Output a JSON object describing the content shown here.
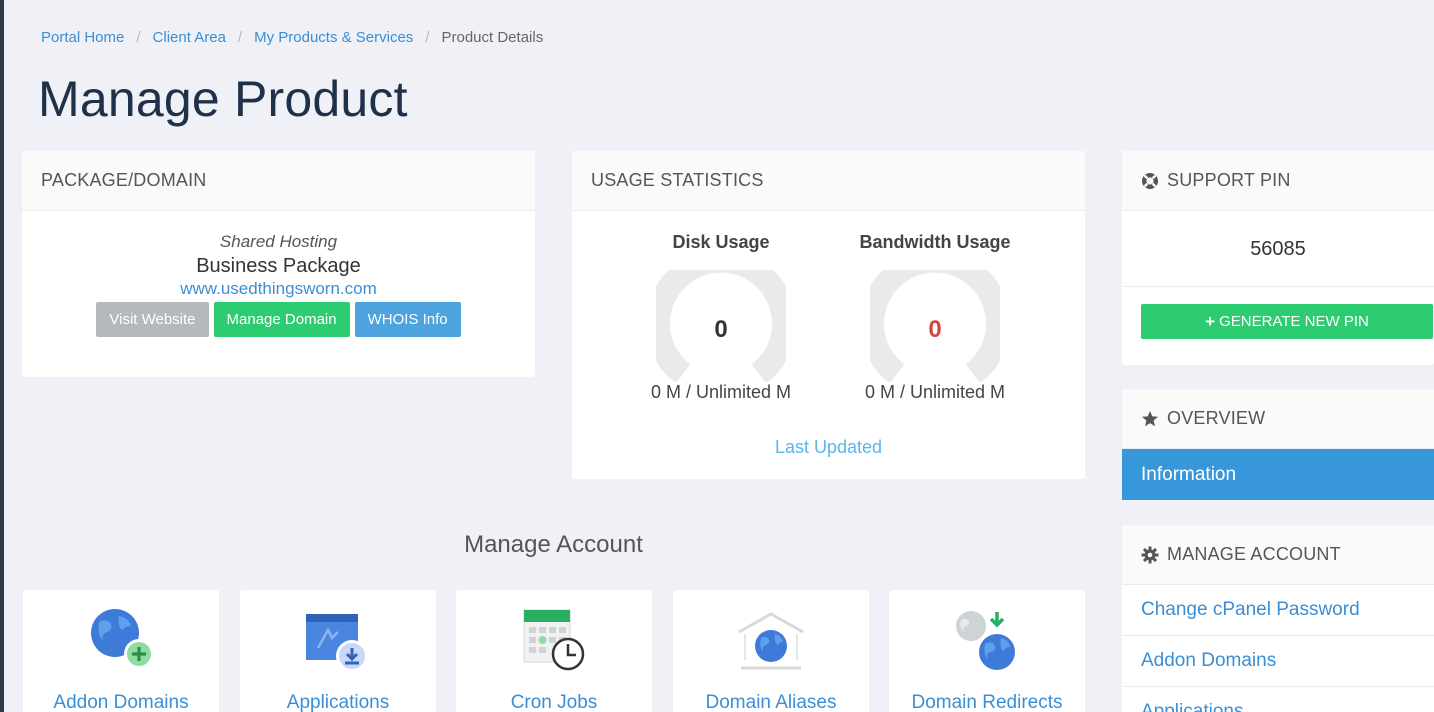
{
  "breadcrumb": {
    "items": [
      "Portal Home",
      "Client Area",
      "My Products & Services"
    ],
    "current": "Product Details"
  },
  "page_title": "Manage Product",
  "package_panel": {
    "heading": "PACKAGE/DOMAIN",
    "type": "Shared Hosting",
    "name": "Business Package",
    "domain": "www.usedthingsworn.com",
    "buttons": {
      "visit": "Visit Website",
      "manage_domain": "Manage Domain",
      "whois": "WHOIS Info"
    }
  },
  "usage_panel": {
    "heading": "USAGE STATISTICS",
    "disk": {
      "label": "Disk Usage",
      "value": "0",
      "amount": "0 M / Unlimited M"
    },
    "bandwidth": {
      "label": "Bandwidth Usage",
      "value": "0",
      "amount": "0 M / Unlimited M"
    },
    "last_updated": "Last Updated"
  },
  "support_pin": {
    "heading": "SUPPORT PIN",
    "icon": "life-ring-icon",
    "value": "56085",
    "button": "GENERATE NEW PIN"
  },
  "overview": {
    "heading": "OVERVIEW",
    "icon": "star-icon",
    "active_item": "Information"
  },
  "manage_sidebar": {
    "heading": "MANAGE ACCOUNT",
    "icon": "gear-icon",
    "links": [
      "Change cPanel Password",
      "Addon Domains",
      "Applications"
    ]
  },
  "manage_account": {
    "heading": "Manage Account",
    "tiles": [
      "Addon Domains",
      "Applications",
      "Cron Jobs",
      "Domain Aliases",
      "Domain Redirects"
    ]
  },
  "colors": {
    "accent_blue": "#3797da",
    "link_blue": "#3b8ed4",
    "green": "#2ecc71",
    "danger_red": "#d9453d",
    "gray_button": "#b5b9bc"
  }
}
